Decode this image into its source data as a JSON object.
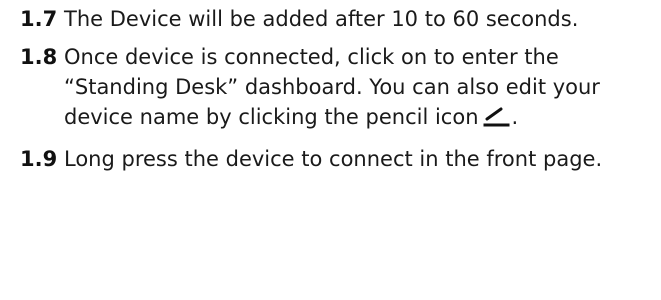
{
  "steps": [
    {
      "number": "1.7",
      "text": "The Device will be added after 10 to 60 seconds."
    },
    {
      "number": "1.8",
      "text_before_icon": "Once device is connected, click on to enter the “Standing Desk” dashboard. You can also edit your device name by clicking the pencil icon",
      "text_after_icon": ".",
      "icon": "pencil-icon"
    },
    {
      "number": "1.9",
      "text": "Long press the device to connect in the front page."
    }
  ]
}
